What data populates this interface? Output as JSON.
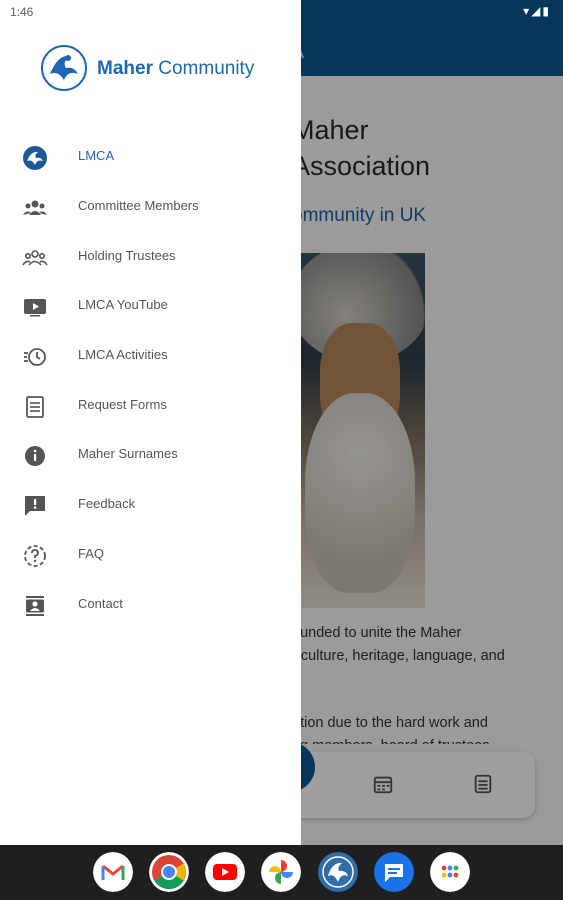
{
  "status_bar": {
    "time": "1:46"
  },
  "background": {
    "appbar_title_fragment": "A",
    "title": "Maher\nAssociation",
    "subtitle": "ommunity in UK",
    "paragraph1": "ounded to unite the Maher\nr culture, heritage, language, and",
    "paragraph2": "ation due to the hard work and\nng members, board of trustees"
  },
  "drawer": {
    "logo": {
      "text_bold": "Maher",
      "text_regular": " Community"
    },
    "items": [
      {
        "label": "LMCA",
        "icon": "lmca-emblem-icon"
      },
      {
        "label": "Committee Members",
        "icon": "group-icon"
      },
      {
        "label": "Holding Trustees",
        "icon": "group-outline-icon"
      },
      {
        "label": "LMCA YouTube",
        "icon": "youtube-icon"
      },
      {
        "label": "LMCA Activities",
        "icon": "history-icon"
      },
      {
        "label": "Request Forms",
        "icon": "form-icon"
      },
      {
        "label": "Maher Surnames",
        "icon": "info-icon"
      },
      {
        "label": "Feedback",
        "icon": "feedback-icon"
      },
      {
        "label": "FAQ",
        "icon": "faq-icon"
      },
      {
        "label": "Contact",
        "icon": "contact-icon"
      }
    ]
  },
  "taskbar": {
    "apps": [
      "gmail-icon",
      "chrome-icon",
      "youtube-app-icon",
      "photos-icon",
      "lmca-app-icon",
      "messages-icon",
      "app-drawer-icon"
    ]
  },
  "colors": {
    "primary": "#0a5791",
    "accent": "#1f66b2",
    "taskbar": "#1f1f1f"
  }
}
